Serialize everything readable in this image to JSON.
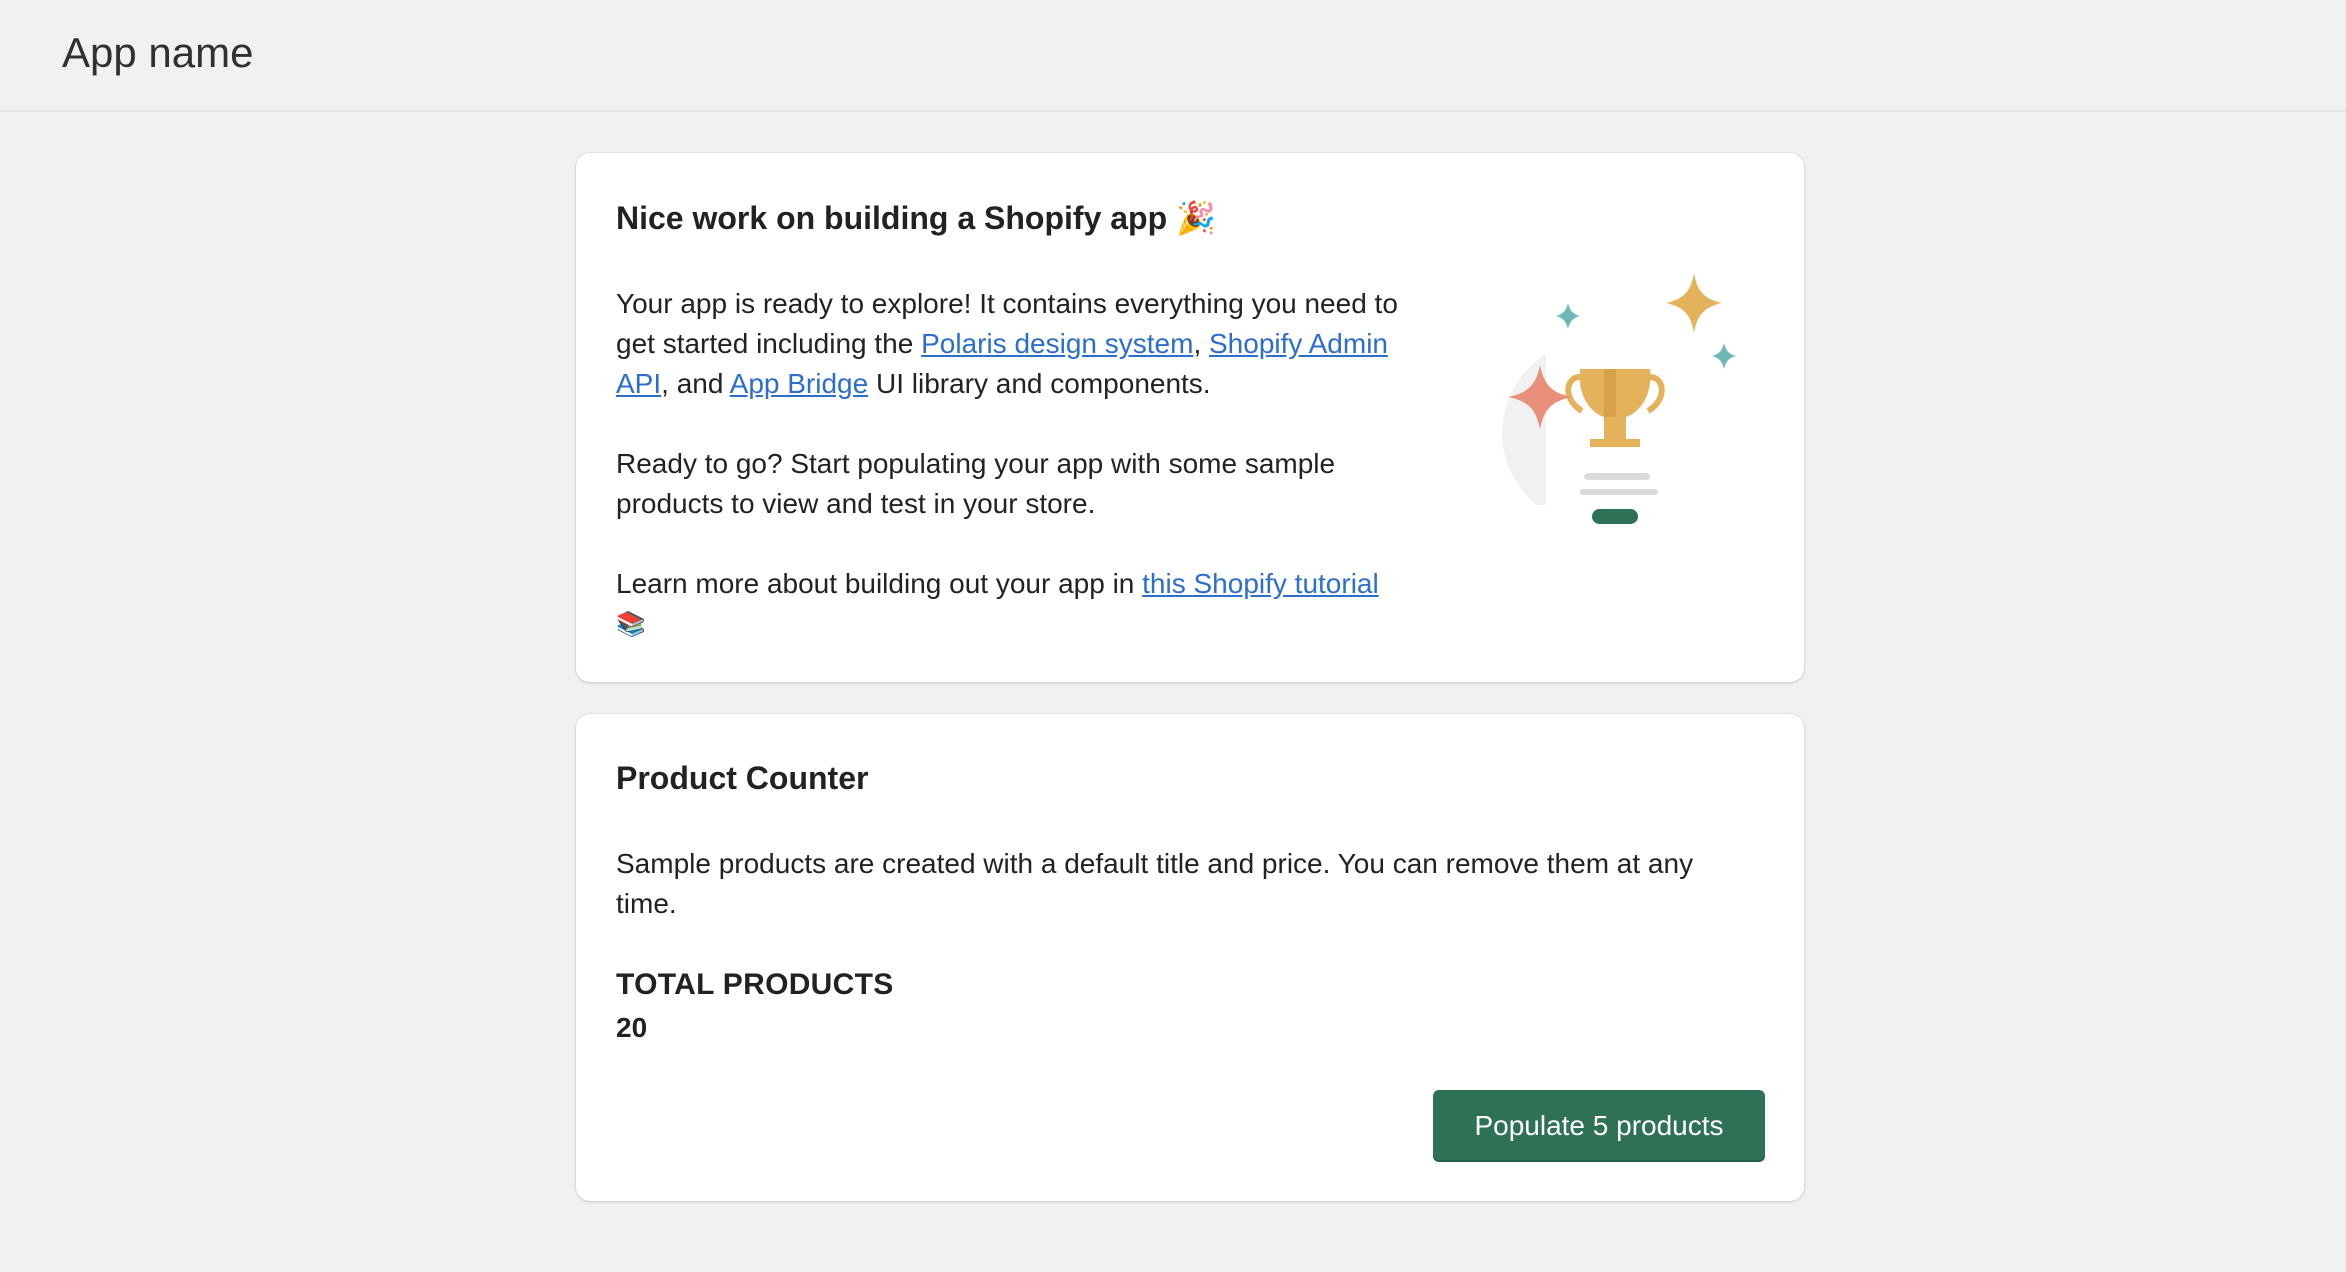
{
  "header": {
    "app_title": "App name"
  },
  "welcome_card": {
    "heading": "Nice work on building a Shopify app",
    "heading_emoji": "🎉",
    "intro_line1": "Your app is ready to explore! It contains everything you need to",
    "intro_line2_pre": "get started including the ",
    "link_polaris": "Polaris design system",
    "comma": ",",
    "link_admin_api_part1": "Shopify Admin",
    "link_admin_api_part2": "API",
    "intro_line3_mid": ", and ",
    "link_app_bridge": "App Bridge",
    "intro_line3_post": " UI library and components.",
    "ready_line1": "Ready to go? Start populating your app with some sample",
    "ready_line2": "products to view and test in your store.",
    "learn_pre": "Learn more about building out your app in ",
    "link_tutorial": "this Shopify tutorial",
    "learn_emoji": "📚",
    "illustration": "trophy-celebration-illustration"
  },
  "counter_card": {
    "heading": "Product Counter",
    "description_line1": "Sample products are created with a default title and price. You can remove them at any",
    "description_line2": "time.",
    "total_label": "TOTAL PRODUCTS",
    "total_value": "20",
    "populate_button": "Populate 5 products"
  },
  "colors": {
    "primary_button": "#2e7157",
    "link": "#2c6ecb",
    "background": "#f1f1f1",
    "trophy_gold": "#e3b25b",
    "sparkle_coral": "#e8907a",
    "sparkle_teal": "#6bb8b7"
  }
}
